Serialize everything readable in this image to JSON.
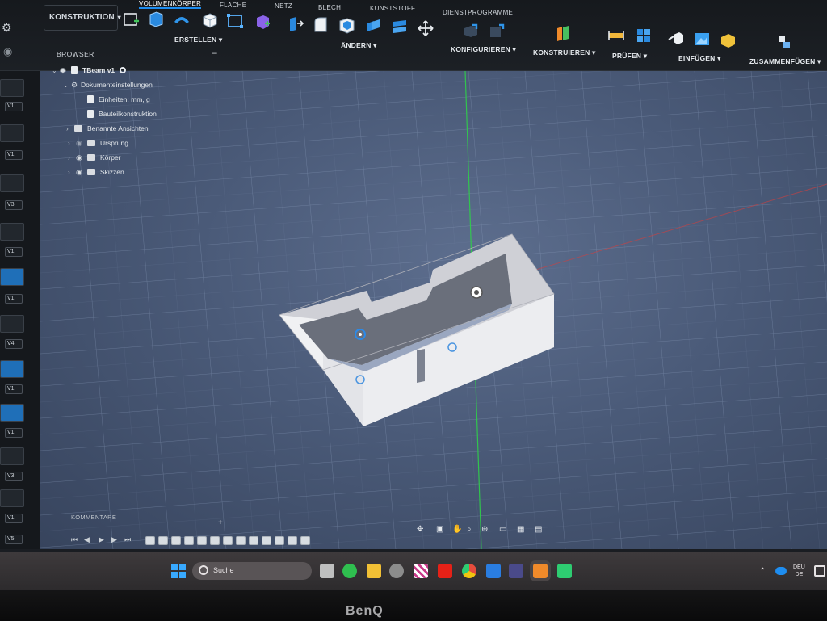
{
  "workspace": {
    "label": "KONSTRUKTION"
  },
  "tabs": [
    {
      "label": "VOLUMENKÖRPER",
      "active": true
    },
    {
      "label": "FLÄCHE"
    },
    {
      "label": "NETZ"
    },
    {
      "label": "BLECH"
    },
    {
      "label": "KUNSTSTOFF"
    },
    {
      "label": "DIENSTPROGRAMME"
    }
  ],
  "groups": {
    "erstellen": "ERSTELLEN",
    "aendern": "ÄNDERN",
    "konfigurieren": "KONFIGURIEREN",
    "konstruieren": "KONSTRUIEREN",
    "pruefen": "PRÜFEN",
    "einfuegen": "EINFÜGEN",
    "zusammenfuegen": "ZUSAMMENFÜGEN"
  },
  "browser": {
    "title": "BROWSER",
    "items": [
      {
        "label": "TBeam v1"
      },
      {
        "label": "Dokumenteinstellungen"
      },
      {
        "label": "Einheiten: mm, g"
      },
      {
        "label": "Bauteilkonstruktion"
      },
      {
        "label": "Benannte Ansichten"
      },
      {
        "label": "Ursprung"
      },
      {
        "label": "Körper"
      },
      {
        "label": "Skizzen"
      }
    ]
  },
  "versions": [
    "V1",
    "V1",
    "V3",
    "V1",
    "V1",
    "V4",
    "V1",
    "V1",
    "V3",
    "V1",
    "V5"
  ],
  "comments": {
    "label": "KOMMENTARE"
  },
  "taskbar": {
    "search_placeholder": "Suche",
    "lang": "DEU",
    "lang_sub": "DE"
  },
  "monitor": {
    "brand": "BenQ"
  },
  "colors": {
    "accent": "#1e8df0",
    "viewport": "#4a5a78",
    "model": "#e3e4e8"
  }
}
